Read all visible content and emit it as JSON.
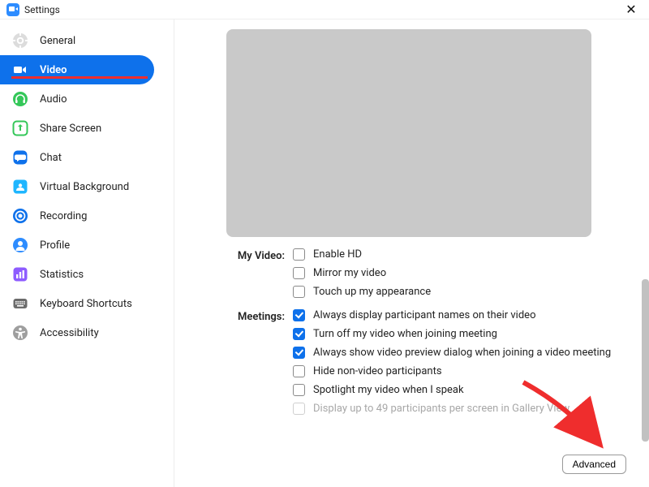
{
  "titlebar": {
    "title": "Settings"
  },
  "sidebar": {
    "items": [
      {
        "id": "general",
        "label": "General"
      },
      {
        "id": "video",
        "label": "Video"
      },
      {
        "id": "audio",
        "label": "Audio"
      },
      {
        "id": "share-screen",
        "label": "Share Screen"
      },
      {
        "id": "chat",
        "label": "Chat"
      },
      {
        "id": "virtual-background",
        "label": "Virtual Background"
      },
      {
        "id": "recording",
        "label": "Recording"
      },
      {
        "id": "profile",
        "label": "Profile"
      },
      {
        "id": "statistics",
        "label": "Statistics"
      },
      {
        "id": "keyboard-shortcuts",
        "label": "Keyboard Shortcuts"
      },
      {
        "id": "accessibility",
        "label": "Accessibility"
      }
    ],
    "active_id": "video"
  },
  "video_settings": {
    "sections": {
      "my_video": {
        "label": "My Video:",
        "options": [
          {
            "key": "enable_hd",
            "label": "Enable HD",
            "checked": false
          },
          {
            "key": "mirror",
            "label": "Mirror my video",
            "checked": false
          },
          {
            "key": "touch_up",
            "label": "Touch up my appearance",
            "checked": false
          }
        ]
      },
      "meetings": {
        "label": "Meetings:",
        "options": [
          {
            "key": "display_names",
            "label": "Always display participant names on their video",
            "checked": true
          },
          {
            "key": "turn_off_join",
            "label": "Turn off my video when joining meeting",
            "checked": true
          },
          {
            "key": "preview_dialog",
            "label": "Always show video preview dialog when joining a video meeting",
            "checked": true
          },
          {
            "key": "hide_nonvideo",
            "label": "Hide non-video participants",
            "checked": false
          },
          {
            "key": "spotlight",
            "label": "Spotlight my video when I speak",
            "checked": false
          },
          {
            "key": "gallery49",
            "label": "Display up to 49 participants per screen in Gallery View",
            "checked": false,
            "disabled": true
          }
        ]
      }
    }
  },
  "buttons": {
    "advanced": "Advanced"
  },
  "icons": {
    "general": {
      "bg": "#dcdcdc",
      "fg": "#ffffff"
    },
    "video": {
      "bg": "#ffffff",
      "fg": "#0e71eb"
    },
    "audio": {
      "bg": "#34c759",
      "fg": "#ffffff"
    },
    "share-screen": {
      "bg": "#34c759",
      "fg": "#ffffff"
    },
    "chat": {
      "bg": "#0e71eb",
      "fg": "#ffffff"
    },
    "virtual-background": {
      "bg": "#1fb6ff",
      "fg": "#ffffff"
    },
    "recording": {
      "bg": "#0e71eb",
      "fg": "#ffffff"
    },
    "profile": {
      "bg": "#2d8cff",
      "fg": "#ffffff"
    },
    "statistics": {
      "bg": "#8e5cff",
      "fg": "#ffffff"
    },
    "keyboard-shortcuts": {
      "bg": "#6b6b6b",
      "fg": "#ffffff"
    },
    "accessibility": {
      "bg": "#9e9e9e",
      "fg": "#ffffff"
    }
  }
}
